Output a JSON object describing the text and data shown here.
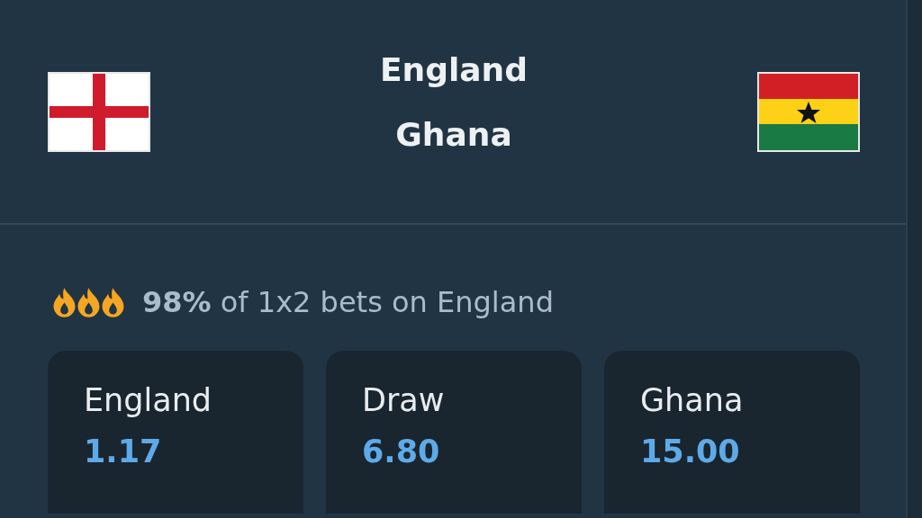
{
  "match": {
    "home": {
      "name": "England"
    },
    "away": {
      "name": "Ghana"
    }
  },
  "bet_stat": "**98%** of 1x2 bets on England",
  "odds": [
    {
      "label": "England",
      "value": "1.17"
    },
    {
      "label": "Draw",
      "value": "6.80"
    },
    {
      "label": "Ghana",
      "value": "15.00"
    }
  ]
}
